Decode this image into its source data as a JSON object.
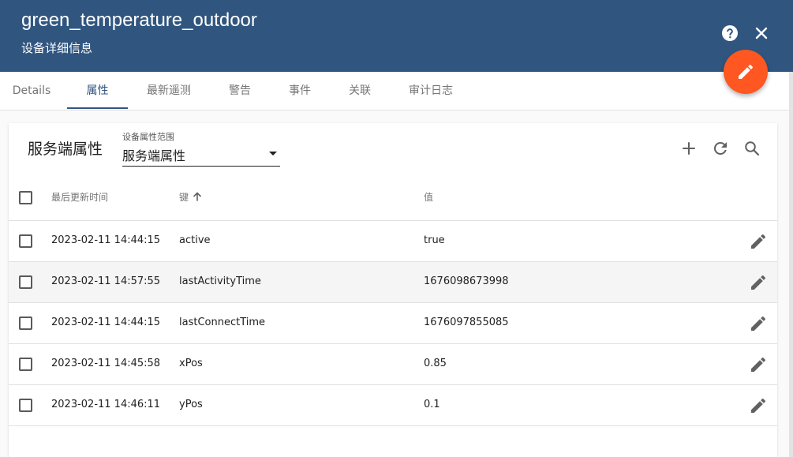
{
  "header": {
    "title": "green_temperature_outdoor",
    "subtitle": "设备详细信息"
  },
  "tabs": [
    {
      "label": "Details"
    },
    {
      "label": "属性",
      "active": true
    },
    {
      "label": "最新遥测"
    },
    {
      "label": "警告"
    },
    {
      "label": "事件"
    },
    {
      "label": "关联"
    },
    {
      "label": "审计日志"
    }
  ],
  "attributes_card": {
    "title": "服务端属性",
    "scope_label": "设备属性范围",
    "scope_value": "服务端属性",
    "columns": {
      "last_update": "最后更新时间",
      "key": "键",
      "value": "值"
    },
    "sort": {
      "column": "key",
      "direction": "ascending"
    },
    "rows": [
      {
        "last_update": "2023-02-11 14:44:15",
        "key": "active",
        "value": "true"
      },
      {
        "last_update": "2023-02-11 14:57:55",
        "key": "lastActivityTime",
        "value": "1676098673998",
        "hovered": true
      },
      {
        "last_update": "2023-02-11 14:44:15",
        "key": "lastConnectTime",
        "value": "1676097855085"
      },
      {
        "last_update": "2023-02-11 14:45:58",
        "key": "xPos",
        "value": "0.85"
      },
      {
        "last_update": "2023-02-11 14:46:11",
        "key": "yPos",
        "value": "0.1"
      }
    ]
  },
  "icons": {
    "help": "help-circle-icon",
    "close": "close-icon",
    "edit_fab": "pencil-icon",
    "add": "plus-icon",
    "refresh": "refresh-icon",
    "search": "search-icon",
    "row_edit": "pencil-icon",
    "sort": "arrow-up-icon"
  },
  "colors": {
    "header": "#305680",
    "accent_fab": "#ff5722",
    "active_tab": "#305680",
    "row_hover": "#f5f5f5"
  }
}
